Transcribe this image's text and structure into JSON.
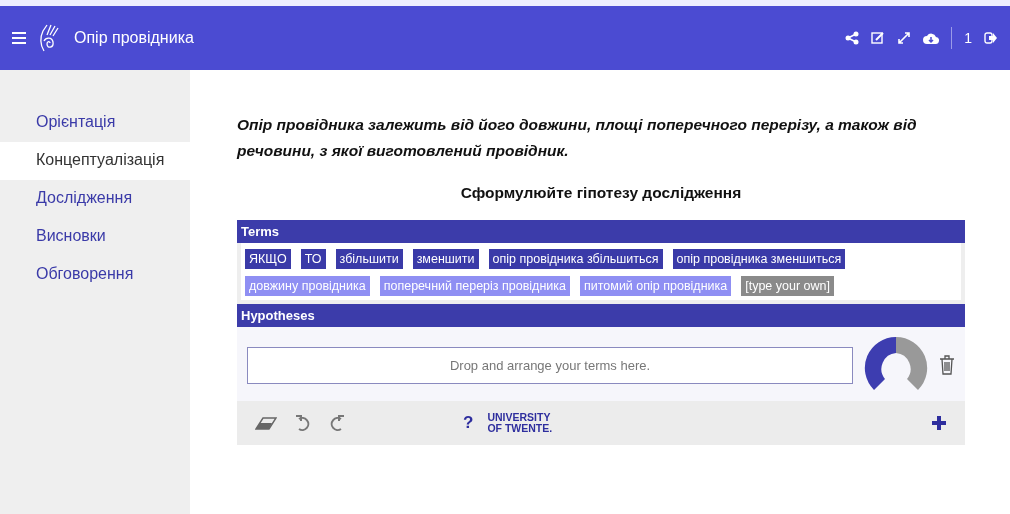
{
  "header": {
    "title": "Опір провідника",
    "counter": "1"
  },
  "sidebar": {
    "items": [
      {
        "label": "Орієнтація",
        "selected": false
      },
      {
        "label": "Концептуалізація",
        "selected": true
      },
      {
        "label": "Дослідження",
        "selected": false
      },
      {
        "label": "Висновки",
        "selected": false
      },
      {
        "label": "Обговорення",
        "selected": false
      }
    ]
  },
  "intro": "Опір провідника залежить від його довжини, площі поперечного перерізу, а також від речовини, з якої виготовлений провідник.",
  "heading": "Сформулюйте гіпотезу дослідження",
  "terms": {
    "title": "Terms",
    "items": [
      {
        "label": "ЯКЩО",
        "kind": "connector"
      },
      {
        "label": "ТО",
        "kind": "connector"
      },
      {
        "label": "збільшити",
        "kind": "connector"
      },
      {
        "label": "зменшити",
        "kind": "connector"
      },
      {
        "label": "опір провідника збільшиться",
        "kind": "connector"
      },
      {
        "label": "опір провідника зменшиться",
        "kind": "connector"
      },
      {
        "label": "довжину провідника",
        "kind": "variable"
      },
      {
        "label": "поперечний переріз провідника",
        "kind": "variable"
      },
      {
        "label": "питомий опір провідника",
        "kind": "variable"
      },
      {
        "label": "[type your own]",
        "kind": "custom"
      }
    ]
  },
  "hypotheses": {
    "title": "Hypotheses",
    "placeholder": "Drop and arrange your terms here."
  },
  "toolbar": {
    "help": "?",
    "logo": [
      "UNIVERSITY",
      "OF TWENTE."
    ]
  }
}
